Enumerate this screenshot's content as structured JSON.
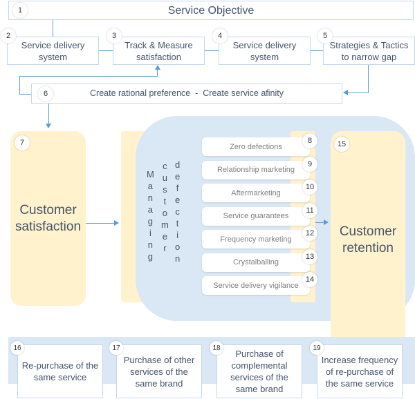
{
  "top": {
    "objective": {
      "number": "1",
      "label": "Service Objective"
    },
    "steps": [
      {
        "number": "2",
        "label": "Service delivery system"
      },
      {
        "number": "3",
        "label": "Track & Measure satisfaction"
      },
      {
        "number": "4",
        "label": "Service delivery system"
      },
      {
        "number": "5",
        "label": "Strategies & Tactics to narrow gap"
      }
    ],
    "preference": {
      "number": "6",
      "label": "Create rational preference  -  Create service afinity"
    }
  },
  "middle": {
    "satisfaction": {
      "number": "7",
      "label": "Customer satisfaction"
    },
    "managing": {
      "col1": [
        "M",
        "a",
        "n",
        "a",
        "g",
        "i",
        "n",
        "g"
      ],
      "col2": [
        "c",
        "u",
        "s",
        "t",
        "o",
        "m",
        "e",
        "r"
      ],
      "col3": [
        "d",
        "e",
        "f",
        "e",
        "c",
        "t",
        "i",
        "o",
        "n"
      ]
    },
    "levers": [
      {
        "number": "8",
        "label": "Zero defections"
      },
      {
        "number": "9",
        "label": "Relationship marketing"
      },
      {
        "number": "10",
        "label": "Aftermarketing"
      },
      {
        "number": "11",
        "label": "Service guarantees"
      },
      {
        "number": "12",
        "label": "Frequency marketing"
      },
      {
        "number": "13",
        "label": "Crystalballing"
      },
      {
        "number": "14",
        "label": "Service delivery vigilance"
      }
    ],
    "retention": {
      "number": "15",
      "label": "Customer retention"
    }
  },
  "bottom": {
    "outcomes": [
      {
        "number": "16",
        "label": "Re-purchase of the same service"
      },
      {
        "number": "17",
        "label": "Purchase of other services of the same brand"
      },
      {
        "number": "18",
        "label": "Purchase of complemental services of the same brand"
      },
      {
        "number": "19",
        "label": "Increase frequency of re-purchase of the same service"
      }
    ]
  },
  "colors": {
    "accent": "#5b9bd5",
    "yellow": "#fff2cc",
    "blue": "#dae7f5",
    "border": "#c5d6ea"
  }
}
